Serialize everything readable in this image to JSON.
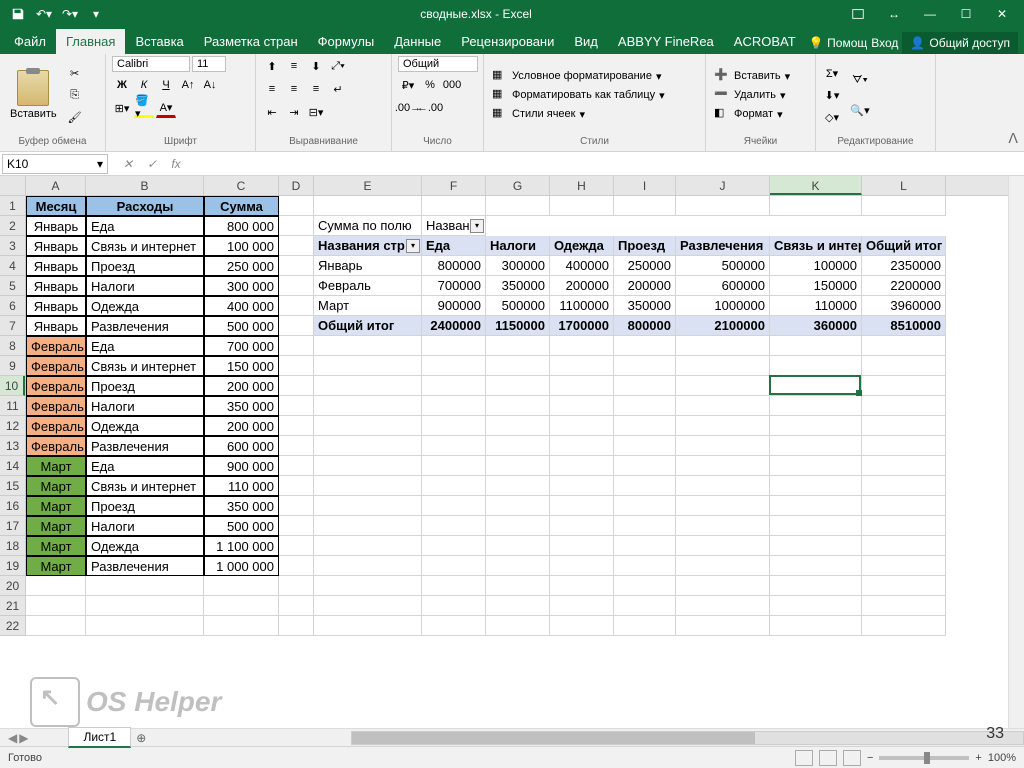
{
  "titlebar": {
    "title": "сводные.xlsx - Excel"
  },
  "tabs": {
    "file": "Файл",
    "home": "Главная",
    "insert": "Вставка",
    "layout": "Разметка стран",
    "formulas": "Формулы",
    "data": "Данные",
    "review": "Рецензировани",
    "view": "Вид",
    "abbyy": "ABBYY FineRea",
    "acrobat": "ACROBAT",
    "help": "Помощ",
    "signin": "Вход",
    "share": "Общий доступ"
  },
  "ribbon": {
    "paste": "Вставить",
    "clipboard": "Буфер обмена",
    "font_name": "Calibri",
    "font_size": "11",
    "font": "Шрифт",
    "alignment": "Выравнивание",
    "number_format": "Общий",
    "number": "Число",
    "cond_fmt": "Условное форматирование",
    "as_table": "Форматировать как таблицу",
    "cell_styles": "Стили ячеек",
    "styles": "Стили",
    "insert_c": "Вставить",
    "delete_c": "Удалить",
    "format_c": "Формат",
    "cells": "Ячейки",
    "editing": "Редактирование"
  },
  "namebox": "K10",
  "columns": [
    {
      "id": "A",
      "w": 60
    },
    {
      "id": "B",
      "w": 118
    },
    {
      "id": "C",
      "w": 75
    },
    {
      "id": "D",
      "w": 35
    },
    {
      "id": "E",
      "w": 108
    },
    {
      "id": "F",
      "w": 64
    },
    {
      "id": "G",
      "w": 64
    },
    {
      "id": "H",
      "w": 64
    },
    {
      "id": "I",
      "w": 62
    },
    {
      "id": "J",
      "w": 94
    },
    {
      "id": "K",
      "w": 92
    },
    {
      "id": "L",
      "w": 84
    }
  ],
  "left_table": {
    "headers": [
      "Месяц",
      "Расходы",
      "Сумма"
    ],
    "rows": [
      {
        "m": "Январь",
        "cat": "Еда",
        "sum": "800 000",
        "cls": ""
      },
      {
        "m": "Январь",
        "cat": "Связь и интернет",
        "sum": "100 000",
        "cls": ""
      },
      {
        "m": "Январь",
        "cat": "Проезд",
        "sum": "250 000",
        "cls": ""
      },
      {
        "m": "Январь",
        "cat": "Налоги",
        "sum": "300 000",
        "cls": ""
      },
      {
        "m": "Январь",
        "cat": "Одежда",
        "sum": "400 000",
        "cls": ""
      },
      {
        "m": "Январь",
        "cat": "Развлечения",
        "sum": "500 000",
        "cls": ""
      },
      {
        "m": "Февраль",
        "cat": "Еда",
        "sum": "700 000",
        "cls": "orange"
      },
      {
        "m": "Февраль",
        "cat": "Связь и интернет",
        "sum": "150 000",
        "cls": "orange"
      },
      {
        "m": "Февраль",
        "cat": "Проезд",
        "sum": "200 000",
        "cls": "orange"
      },
      {
        "m": "Февраль",
        "cat": "Налоги",
        "sum": "350 000",
        "cls": "orange"
      },
      {
        "m": "Февраль",
        "cat": "Одежда",
        "sum": "200 000",
        "cls": "orange"
      },
      {
        "m": "Февраль",
        "cat": "Развлечения",
        "sum": "600 000",
        "cls": "orange"
      },
      {
        "m": "Март",
        "cat": "Еда",
        "sum": "900 000",
        "cls": "green"
      },
      {
        "m": "Март",
        "cat": "Связь и интернет",
        "sum": "110 000",
        "cls": "green"
      },
      {
        "m": "Март",
        "cat": "Проезд",
        "sum": "350 000",
        "cls": "green"
      },
      {
        "m": "Март",
        "cat": "Налоги",
        "sum": "500 000",
        "cls": "green"
      },
      {
        "m": "Март",
        "cat": "Одежда",
        "sum": "1 100 000",
        "cls": "green"
      },
      {
        "m": "Март",
        "cat": "Развлечения",
        "sum": "1 000 000",
        "cls": "green"
      }
    ]
  },
  "pivot": {
    "e2": "Сумма по полю",
    "f2": "Назван",
    "e3": "Названия стр",
    "cols": [
      "Еда",
      "Налоги",
      "Одежда",
      "Проезд",
      "Развлечения",
      "Связь и интер",
      "Общий итог"
    ],
    "rows": [
      {
        "label": "Январь",
        "vals": [
          "800000",
          "300000",
          "400000",
          "250000",
          "500000",
          "100000",
          "2350000"
        ]
      },
      {
        "label": "Февраль",
        "vals": [
          "700000",
          "350000",
          "200000",
          "200000",
          "600000",
          "150000",
          "2200000"
        ]
      },
      {
        "label": "Март",
        "vals": [
          "900000",
          "500000",
          "1100000",
          "350000",
          "1000000",
          "110000",
          "3960000"
        ]
      }
    ],
    "total_label": "Общий итог",
    "total_vals": [
      "2400000",
      "1150000",
      "1700000",
      "800000",
      "2100000",
      "360000",
      "8510000"
    ]
  },
  "sheet_tab": "Лист1",
  "status": {
    "ready": "Готово",
    "zoom": "100%"
  },
  "watermark": "OS Helper",
  "page_num": "33"
}
